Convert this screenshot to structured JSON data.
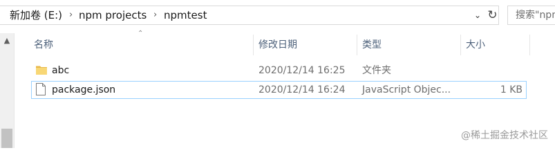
{
  "address_bar": {
    "breadcrumbs": [
      "新加卷 (E:)",
      "npm projects",
      "npmtest"
    ],
    "separator": "›",
    "dropdown_icon": "chevron-down-icon",
    "refresh_icon": "refresh-icon",
    "search_placeholder": "搜索\"npn"
  },
  "columns": {
    "name": "名称",
    "modified": "修改日期",
    "type": "类型",
    "size": "大小"
  },
  "files": [
    {
      "name": "abc",
      "modified": "2020/12/14 16:25",
      "type": "文件夹",
      "size": "",
      "icon": "folder-icon"
    },
    {
      "name": "package.json",
      "modified": "2020/12/14 16:24",
      "type": "JavaScript Objec...",
      "size": "1 KB",
      "icon": "file-icon"
    }
  ],
  "watermark": "@稀土掘金技术社区",
  "colors": {
    "header_text": "#4c607a",
    "folder": "#f8d775",
    "selection_border": "#99d1ff"
  }
}
